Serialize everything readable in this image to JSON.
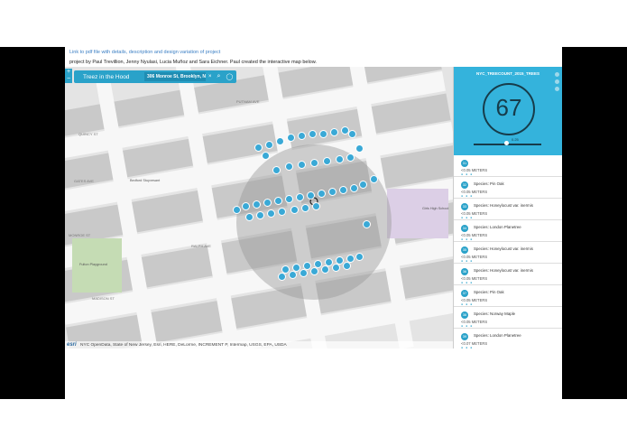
{
  "header": {
    "link_text": "Link to pdf file with details, description and design variation of project",
    "credit_text": "project by Paul Trevillion, Jenny Nyulasi, Lucia Muñoz and Sara Eichner. Paul created the interactive map below."
  },
  "map": {
    "zoom_in": "+",
    "zoom_out": "−",
    "app_title": "Treez in the Hood",
    "search_value": "306 Monroe St, Brooklyn, N",
    "clear_symbol": "×",
    "attribution_logo": "esri",
    "attribution": "NYC OpenData, State of New Jersey, Esri, HERE, DeLorme, INCREMENT P, Intermap, USGS, EPA, USDA",
    "streets": [
      "QUINCY ST",
      "GATES AVE",
      "MONROE ST",
      "MADISON ST",
      "PUTNAM AVE",
      "RALPH AVE"
    ],
    "places": [
      "Fulton Playground",
      "Girls High School",
      "Bedford Stuyvesant"
    ]
  },
  "panel": {
    "title": "NYC_TREECOUNT_2015_TREES",
    "count": "67",
    "slider_value": "0.25",
    "items": [
      {
        "badge": "31",
        "species": "",
        "measure": "<0.05 METERS"
      },
      {
        "badge": "32",
        "species": "Species: Pin Oak",
        "measure": "<0.05 METERS"
      },
      {
        "badge": "33",
        "species": "Species: Honeylocust var. inermis",
        "measure": "<0.05 METERS"
      },
      {
        "badge": "34",
        "species": "Species: London Planetree",
        "measure": "<0.05 METERS"
      },
      {
        "badge": "35",
        "species": "Species: Honeylocust var. inermis",
        "measure": "<0.05 METERS"
      },
      {
        "badge": "36",
        "species": "Species: Honeylocust var. inermis",
        "measure": "<0.05 METERS"
      },
      {
        "badge": "37",
        "species": "Species: Pin Oak",
        "measure": "<0.05 METERS"
      },
      {
        "badge": "38",
        "species": "Species: Norway Maple",
        "measure": "<0.05 METERS"
      },
      {
        "badge": "39",
        "species": "Species: London Planetree",
        "measure": "<0.07 METERS"
      },
      {
        "badge": "40",
        "species": "Species: Honeylocust var. inermis",
        "measure": ""
      }
    ]
  },
  "colors": {
    "accent": "#2aa2c9",
    "panel_head": "#34b3dc",
    "count_ring": "#173c4a"
  }
}
